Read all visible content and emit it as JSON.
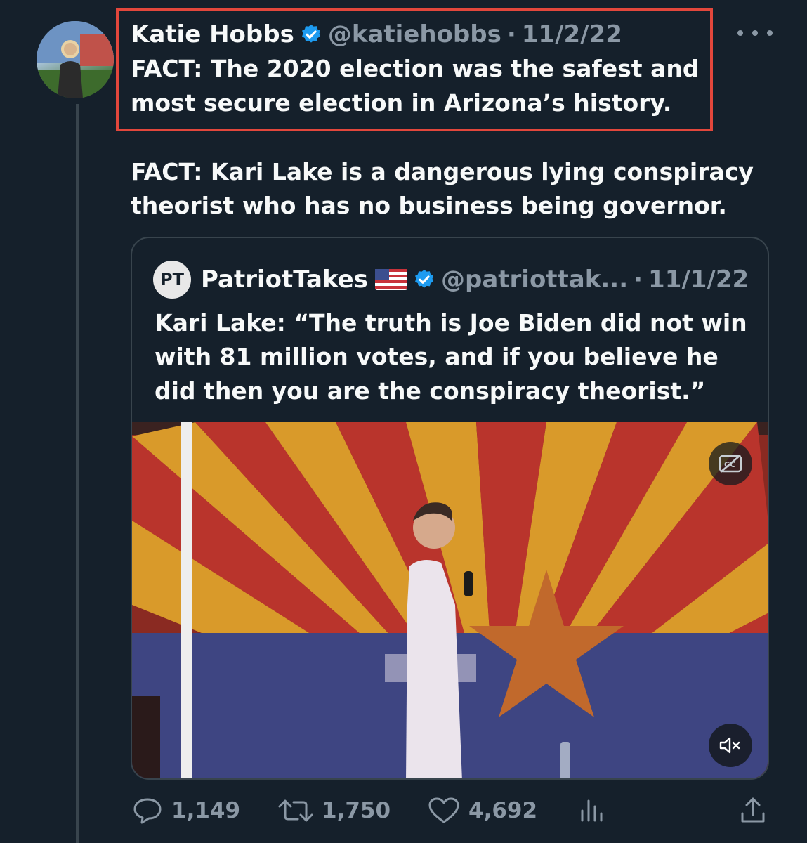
{
  "tweet": {
    "author_name": "Katie Hobbs",
    "handle": "@katiehobbs",
    "separator": "·",
    "date": "11/2/22",
    "lines": [
      "FACT: The 2020 election was the safest and",
      "most secure election in Arizona’s history.",
      "FACT: Kari Lake is a dangerous lying conspiracy",
      "theorist who has no business being governor."
    ]
  },
  "quote": {
    "avatar_text": "PT",
    "author_name": "PatriotTakes",
    "handle": "@patriottak...",
    "separator": "·",
    "date": "11/1/22",
    "lines": [
      "Kari Lake: “The truth is Joe Biden did not win",
      "with 81 million votes, and if you believe he",
      "did then you are the conspiracy theorist.”"
    ]
  },
  "actions": {
    "replies": "1,149",
    "retweets": "1,750",
    "likes": "4,692"
  },
  "colors": {
    "background": "#15202b",
    "text": "#f7f9f9",
    "muted": "#8b98a5",
    "verified": "#1d9bf0",
    "highlight": "#e2473c"
  },
  "icons": [
    "more-icon",
    "verified-icon",
    "flag-icon",
    "captions-icon",
    "mute-icon",
    "reply-icon",
    "retweet-icon",
    "like-icon",
    "views-icon",
    "share-icon"
  ]
}
